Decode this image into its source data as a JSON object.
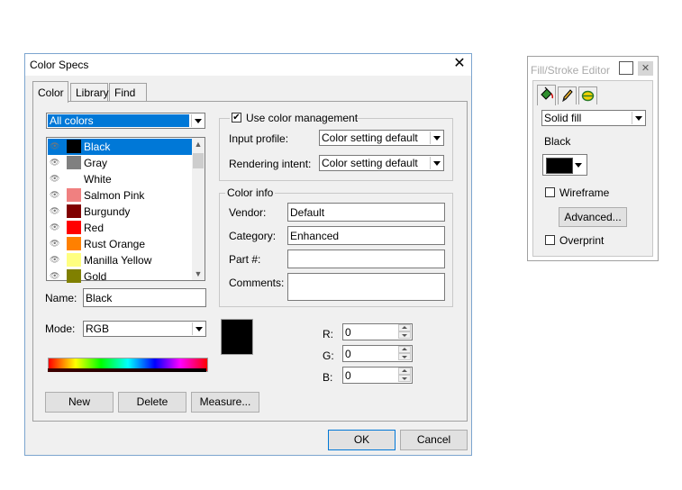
{
  "dialog": {
    "title": "Color Specs",
    "close_glyph": "✕",
    "tabs": [
      {
        "label": "Color",
        "active": true
      },
      {
        "label": "Library",
        "active": false
      },
      {
        "label": "Find",
        "active": false
      }
    ],
    "filter_value": "All colors",
    "colors": [
      {
        "name": "Black",
        "hex": "#000000",
        "selected": true
      },
      {
        "name": "Gray",
        "hex": "#808080"
      },
      {
        "name": "White",
        "hex": "#ffffff"
      },
      {
        "name": "Salmon Pink",
        "hex": "#f08080"
      },
      {
        "name": "Burgundy",
        "hex": "#800000"
      },
      {
        "name": "Red",
        "hex": "#ff0000"
      },
      {
        "name": "Rust Orange",
        "hex": "#ff8000"
      },
      {
        "name": "Manilla Yellow",
        "hex": "#ffff80"
      },
      {
        "name": "Gold",
        "hex": "#808000"
      }
    ],
    "name_label": "Name:",
    "name_value": "Black",
    "mode_label": "Mode:",
    "mode_value": "RGB",
    "preview_color": "#000000",
    "color_management": {
      "checkbox_label": "Use color management",
      "checked": true,
      "input_profile_label": "Input profile:",
      "input_profile_value": "Color setting default",
      "rendering_intent_label": "Rendering intent:",
      "rendering_intent_value": "Color setting default"
    },
    "color_info": {
      "group_label": "Color info",
      "vendor_label": "Vendor:",
      "vendor_value": "Default",
      "category_label": "Category:",
      "category_value": "Enhanced",
      "part_label": "Part #:",
      "part_value": "",
      "comments_label": "Comments:",
      "comments_value": ""
    },
    "rgb": {
      "r_label": "R:",
      "r_value": "0",
      "g_label": "G:",
      "g_value": "0",
      "b_label": "B:",
      "b_value": "0"
    },
    "buttons": {
      "new": "New",
      "delete": "Delete",
      "measure": "Measure...",
      "ok": "OK",
      "cancel": "Cancel"
    },
    "accent_color": "#0078d7"
  },
  "fill_stroke_editor": {
    "title": "Fill/Stroke Editor",
    "close_glyph": "✕",
    "tab_icons": [
      "paint-bucket-icon",
      "pencil-icon",
      "globe-icon"
    ],
    "fill_type": "Solid fill",
    "color_name": "Black",
    "swatch_color": "#000000",
    "wireframe_label": "Wireframe",
    "wireframe_checked": false,
    "advanced_button": "Advanced...",
    "overprint_label": "Overprint",
    "overprint_checked": false
  }
}
